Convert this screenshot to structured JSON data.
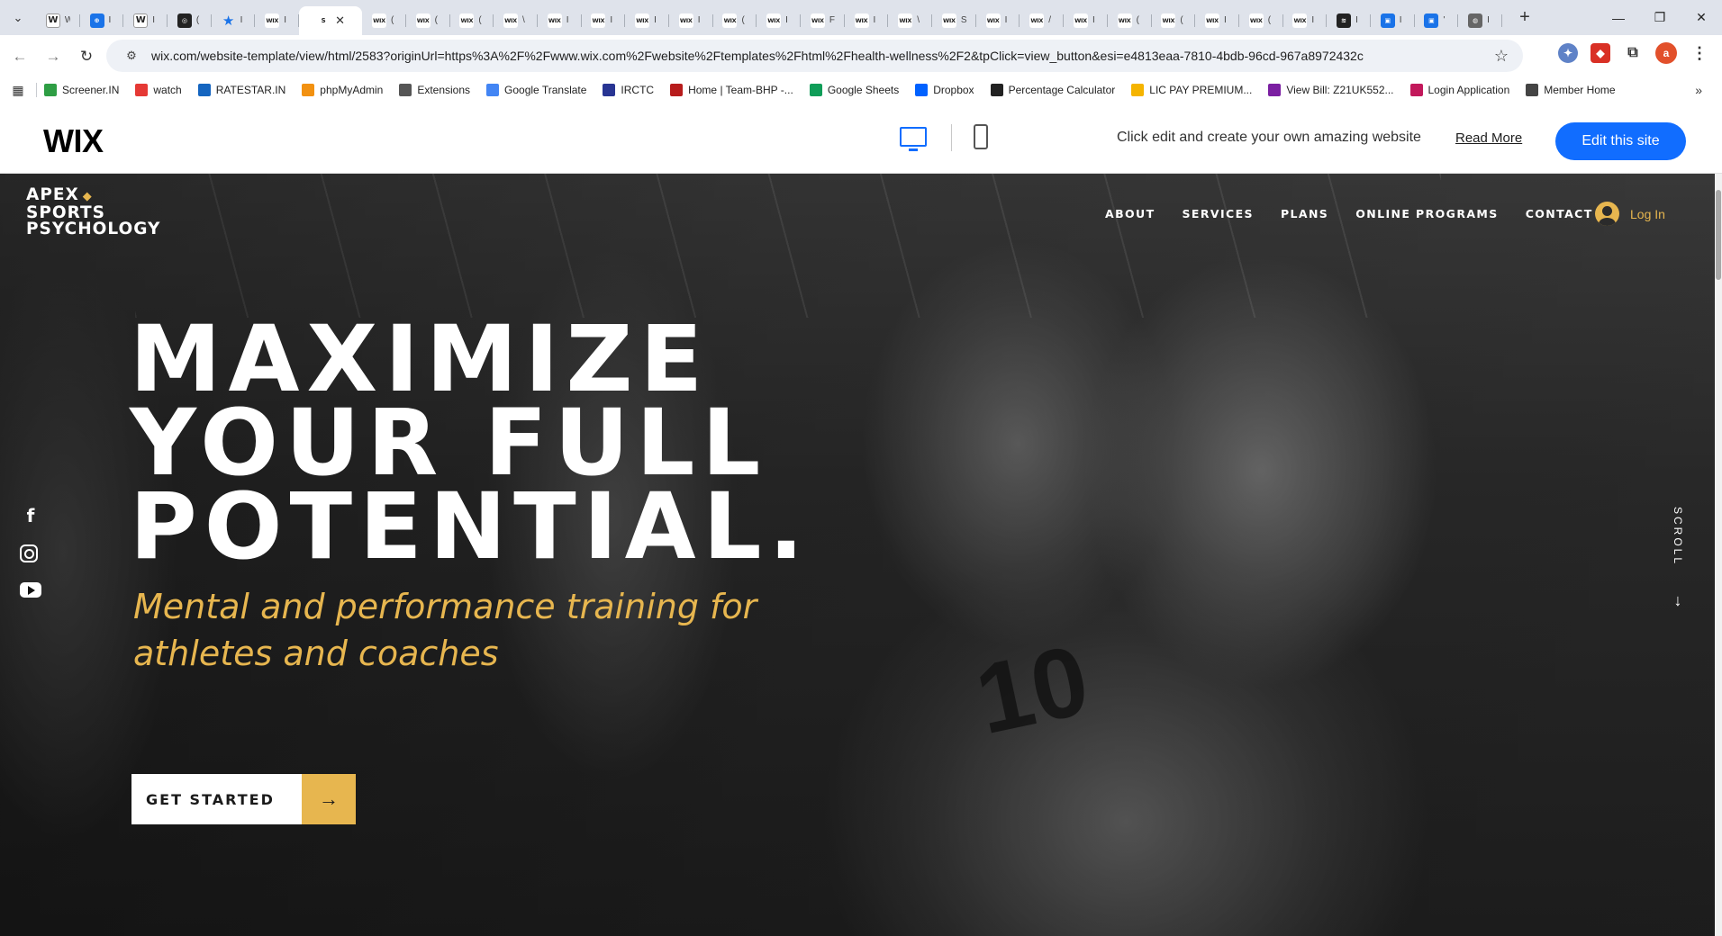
{
  "browser": {
    "tabs": [
      {
        "icon": "W",
        "label": "W",
        "kind": "w"
      },
      {
        "icon": "⊕",
        "label": "I",
        "kind": "blue"
      },
      {
        "icon": "W",
        "label": "I",
        "kind": "w"
      },
      {
        "icon": "◎",
        "label": "(",
        "kind": "dark"
      },
      {
        "icon": "★",
        "label": "I",
        "kind": "star"
      },
      {
        "icon": "WIX",
        "label": "I",
        "kind": "wix"
      },
      {
        "icon": "WIX",
        "label": "(",
        "kind": "wix"
      },
      {
        "icon": "WIX",
        "label": "(",
        "kind": "wix"
      },
      {
        "icon": "WIX",
        "label": "(",
        "kind": "wix"
      },
      {
        "icon": "WIX",
        "label": "\\",
        "kind": "wix"
      },
      {
        "icon": "WIX",
        "label": "I",
        "kind": "wix"
      },
      {
        "icon": "WIX",
        "label": "I",
        "kind": "wix"
      },
      {
        "icon": "WIX",
        "label": "I",
        "kind": "wix"
      },
      {
        "icon": "WIX",
        "label": "I",
        "kind": "wix"
      },
      {
        "icon": "WIX",
        "label": "(",
        "kind": "wix"
      },
      {
        "icon": "WIX",
        "label": "I",
        "kind": "wix"
      },
      {
        "icon": "WIX",
        "label": "F",
        "kind": "wix"
      },
      {
        "icon": "WIX",
        "label": "I",
        "kind": "wix"
      },
      {
        "icon": "WIX",
        "label": "\\",
        "kind": "wix"
      },
      {
        "icon": "WIX",
        "label": "S",
        "kind": "wix"
      },
      {
        "icon": "WIX",
        "label": "I",
        "kind": "wix"
      },
      {
        "icon": "WIX",
        "label": "/",
        "kind": "wix"
      },
      {
        "icon": "WIX",
        "label": "I",
        "kind": "wix"
      },
      {
        "icon": "WIX",
        "label": "(",
        "kind": "wix"
      },
      {
        "icon": "WIX",
        "label": "(",
        "kind": "wix"
      },
      {
        "icon": "WIX",
        "label": "I",
        "kind": "wix"
      },
      {
        "icon": "WIX",
        "label": "(",
        "kind": "wix"
      },
      {
        "icon": "WIX",
        "label": "I",
        "kind": "wix"
      },
      {
        "icon": "≋",
        "label": "I",
        "kind": "dark"
      },
      {
        "icon": "▣",
        "label": "I",
        "kind": "blue"
      },
      {
        "icon": "▣",
        "label": "'",
        "kind": "blue"
      },
      {
        "icon": "◍",
        "label": "I",
        "kind": "gray"
      }
    ],
    "active_tab": {
      "icon": "S",
      "label": ""
    },
    "url": "wix.com/website-template/view/html/2583?originUrl=https%3A%2F%2Fwww.wix.com%2Fwebsite%2Ftemplates%2Fhtml%2Fhealth-wellness%2F2&tpClick=view_button&esi=e4813eaa-7810-4bdb-96cd-967a8972432c",
    "avatar_letter": "a",
    "bookmarks": [
      {
        "label": "Screener.IN",
        "color": "#2e9e44"
      },
      {
        "label": "watch",
        "color": "#e53935"
      },
      {
        "label": "RATESTAR.IN",
        "color": "#1565c0"
      },
      {
        "label": "phpMyAdmin",
        "color": "#f29111"
      },
      {
        "label": "Extensions",
        "color": "#555555"
      },
      {
        "label": "Google Translate",
        "color": "#4285f4"
      },
      {
        "label": "IRCTC",
        "color": "#283593"
      },
      {
        "label": "Home | Team-BHP -...",
        "color": "#b71c1c"
      },
      {
        "label": "Google Sheets",
        "color": "#0f9d58"
      },
      {
        "label": "Dropbox",
        "color": "#0061ff"
      },
      {
        "label": "Percentage Calculator",
        "color": "#222222"
      },
      {
        "label": "LIC PAY PREMIUM...",
        "color": "#f5b400"
      },
      {
        "label": "View Bill: Z21UK552...",
        "color": "#7b1fa2"
      },
      {
        "label": "Login Application",
        "color": "#c2185b"
      },
      {
        "label": "Member Home",
        "color": "#444444"
      }
    ]
  },
  "wix_bar": {
    "logo": "WIX",
    "message": "Click edit and create your own amazing website",
    "read_more": "Read More",
    "edit_button": "Edit this site"
  },
  "site": {
    "brand_lines": [
      "APEX",
      "SPORTS",
      "PSYCHOLOGY"
    ],
    "nav": [
      "ABOUT",
      "SERVICES",
      "PLANS",
      "ONLINE PROGRAMS",
      "CONTACT"
    ],
    "login": "Log In",
    "headline": [
      "MAXIMIZE",
      "YOUR FULL",
      "POTENTIAL."
    ],
    "subhead": "Mental and performance training for athletes and coaches",
    "cta": "GET STARTED",
    "scroll": "SCROLL",
    "jersey_number": "10"
  },
  "colors": {
    "accent": "#e7b64f",
    "wix_blue": "#116dff"
  }
}
